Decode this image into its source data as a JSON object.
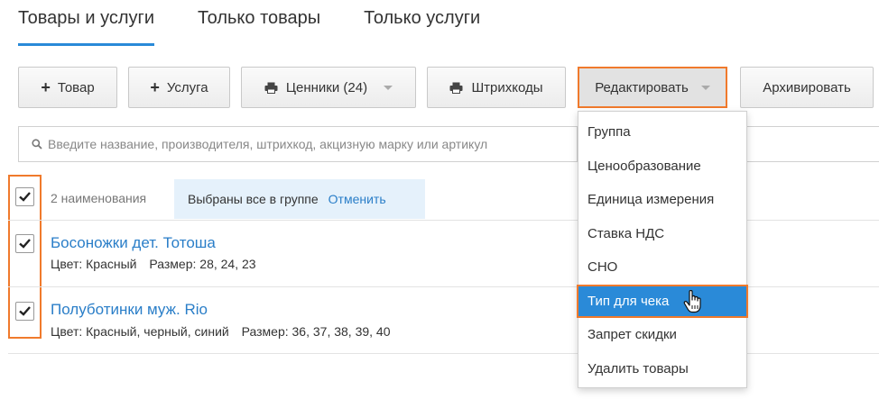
{
  "tabs": [
    {
      "label": "Товары и услуги",
      "active": true
    },
    {
      "label": "Только товары",
      "active": false
    },
    {
      "label": "Только услуги",
      "active": false
    }
  ],
  "toolbar": {
    "add_product": "Товар",
    "add_service": "Услуга",
    "price_tags": "Ценники (24)",
    "barcodes": "Штрихкоды",
    "edit": "Редактировать",
    "archive": "Архивировать"
  },
  "search": {
    "placeholder": "Введите название, производителя, штрихкод, акцизную марку или артикул"
  },
  "selection": {
    "count": "2 наименования",
    "banner": "Выбраны все в группе",
    "cancel": "Отменить"
  },
  "items": [
    {
      "title": "Босоножки дет. Тотоша",
      "color": "Цвет: Красный",
      "size": "Размер: 28, 24, 23",
      "checked": true
    },
    {
      "title": "Полуботинки муж. Rio",
      "color": "Цвет: Красный, черный, синий",
      "size": "Размер: 36, 37, 38, 39, 40",
      "checked": true
    }
  ],
  "edit_menu": [
    {
      "label": "Группа"
    },
    {
      "label": "Ценообразование"
    },
    {
      "label": "Единица измерения"
    },
    {
      "label": "Ставка НДС"
    },
    {
      "label": "СНО"
    },
    {
      "label": "Тип для чека"
    },
    {
      "label": "Запрет скидки"
    },
    {
      "label": "Удалить товары"
    }
  ],
  "edit_menu_highlighted_index": 5,
  "colors": {
    "accent": "#2a8ad8",
    "link": "#2a7ec8",
    "highlight_outline": "#f07a2c",
    "banner_bg": "#e5f1fb"
  }
}
